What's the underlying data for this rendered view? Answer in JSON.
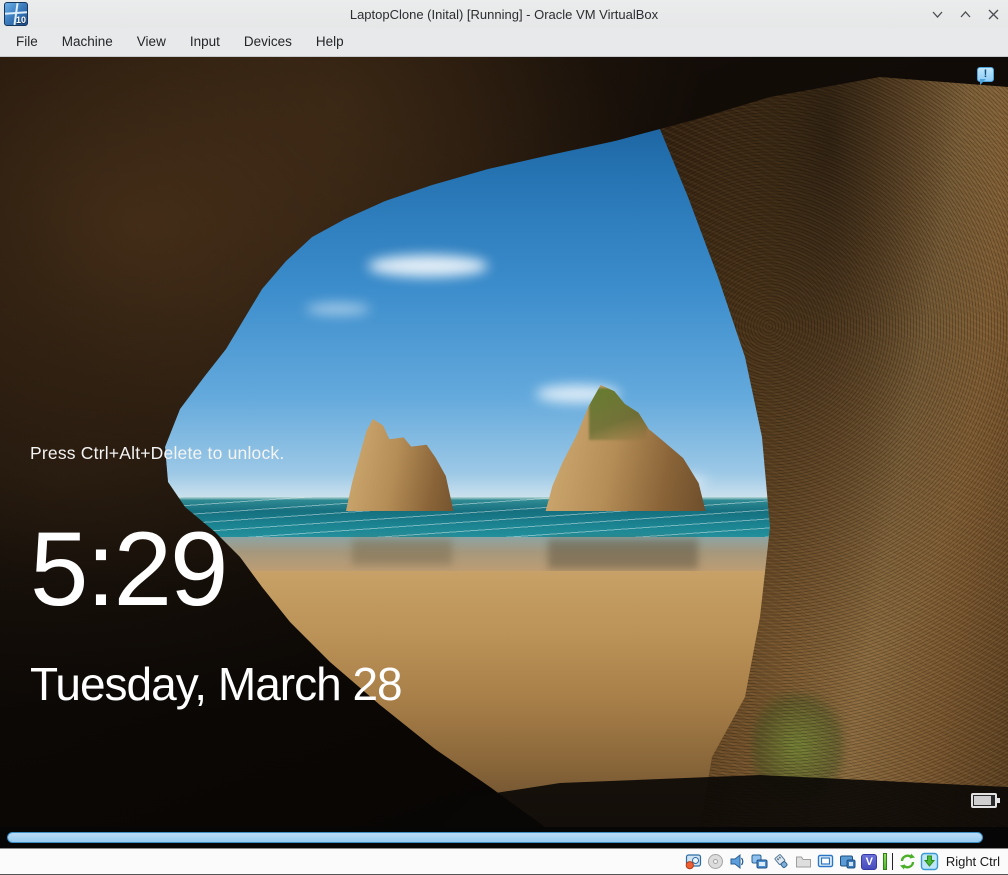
{
  "window": {
    "title": "LaptopClone (Inital) [Running] - Oracle VM VirtualBox",
    "vm_os_badge": "10"
  },
  "menubar": {
    "items": [
      "File",
      "Machine",
      "View",
      "Input",
      "Devices",
      "Help"
    ]
  },
  "lock_screen": {
    "press_text": "Press Ctrl+Alt+Delete to unlock.",
    "time": "5:29",
    "date": "Tuesday, March 28",
    "battery_level_percent_visual": 76
  },
  "notification": {
    "glyph": "!"
  },
  "status_bar": {
    "host_key_label": "Right Ctrl",
    "features_letter": "V",
    "icon_names": [
      "hard-disks-icon",
      "optical-drives-icon",
      "audio-icon",
      "network-icon",
      "usb-icon",
      "shared-folders-icon",
      "display-icon",
      "recording-icon",
      "features-icon",
      "mouse-integration-icon",
      "host-key-icon"
    ]
  },
  "colors": {
    "titlebar_bg": "#e8e9ea",
    "statusbar_bg": "#fbfbfb",
    "scrollbar_thumb": "#a3d2f2",
    "sky_top": "#134f87",
    "sea": "#156f7e",
    "sand": "#b98f5c",
    "notification_blue": "#8fccf4"
  }
}
